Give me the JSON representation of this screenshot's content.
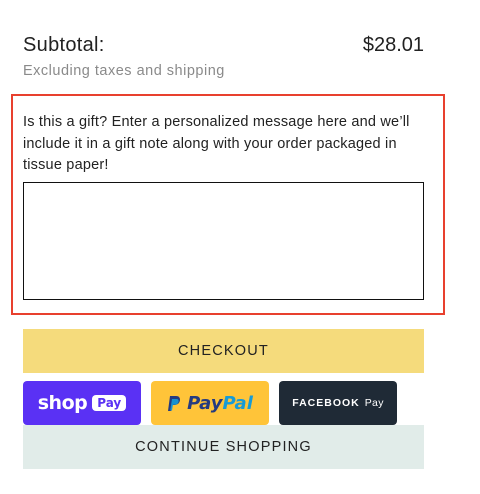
{
  "summary": {
    "subtotal_label": "Subtotal:",
    "subtotal_value": "$28.01",
    "tax_note": "Excluding taxes and shipping"
  },
  "gift": {
    "prompt": "Is this a gift? Enter a personalized message here and we’ll include it in a gift note along with your order packaged in tissue paper!",
    "message_value": "",
    "highlight_color": "#e8402e"
  },
  "actions": {
    "checkout_label": "CHECKOUT",
    "checkout_color": "#f5db7c",
    "continue_label": "CONTINUE SHOPPING",
    "continue_color": "#e1ece9"
  },
  "payment_buttons": {
    "shop_pay": {
      "word": "shop",
      "chip": "Pay",
      "color": "#5a31f4",
      "icon": "shop-pay-logo"
    },
    "paypal": {
      "part1": "Pay",
      "part2": "Pal",
      "color": "#ffc439",
      "icon": "paypal-logo"
    },
    "facebook_pay": {
      "word": "FACEBOOK",
      "pay": "Pay",
      "color": "#1f2a36",
      "icon": "facebook-pay-logo"
    }
  }
}
